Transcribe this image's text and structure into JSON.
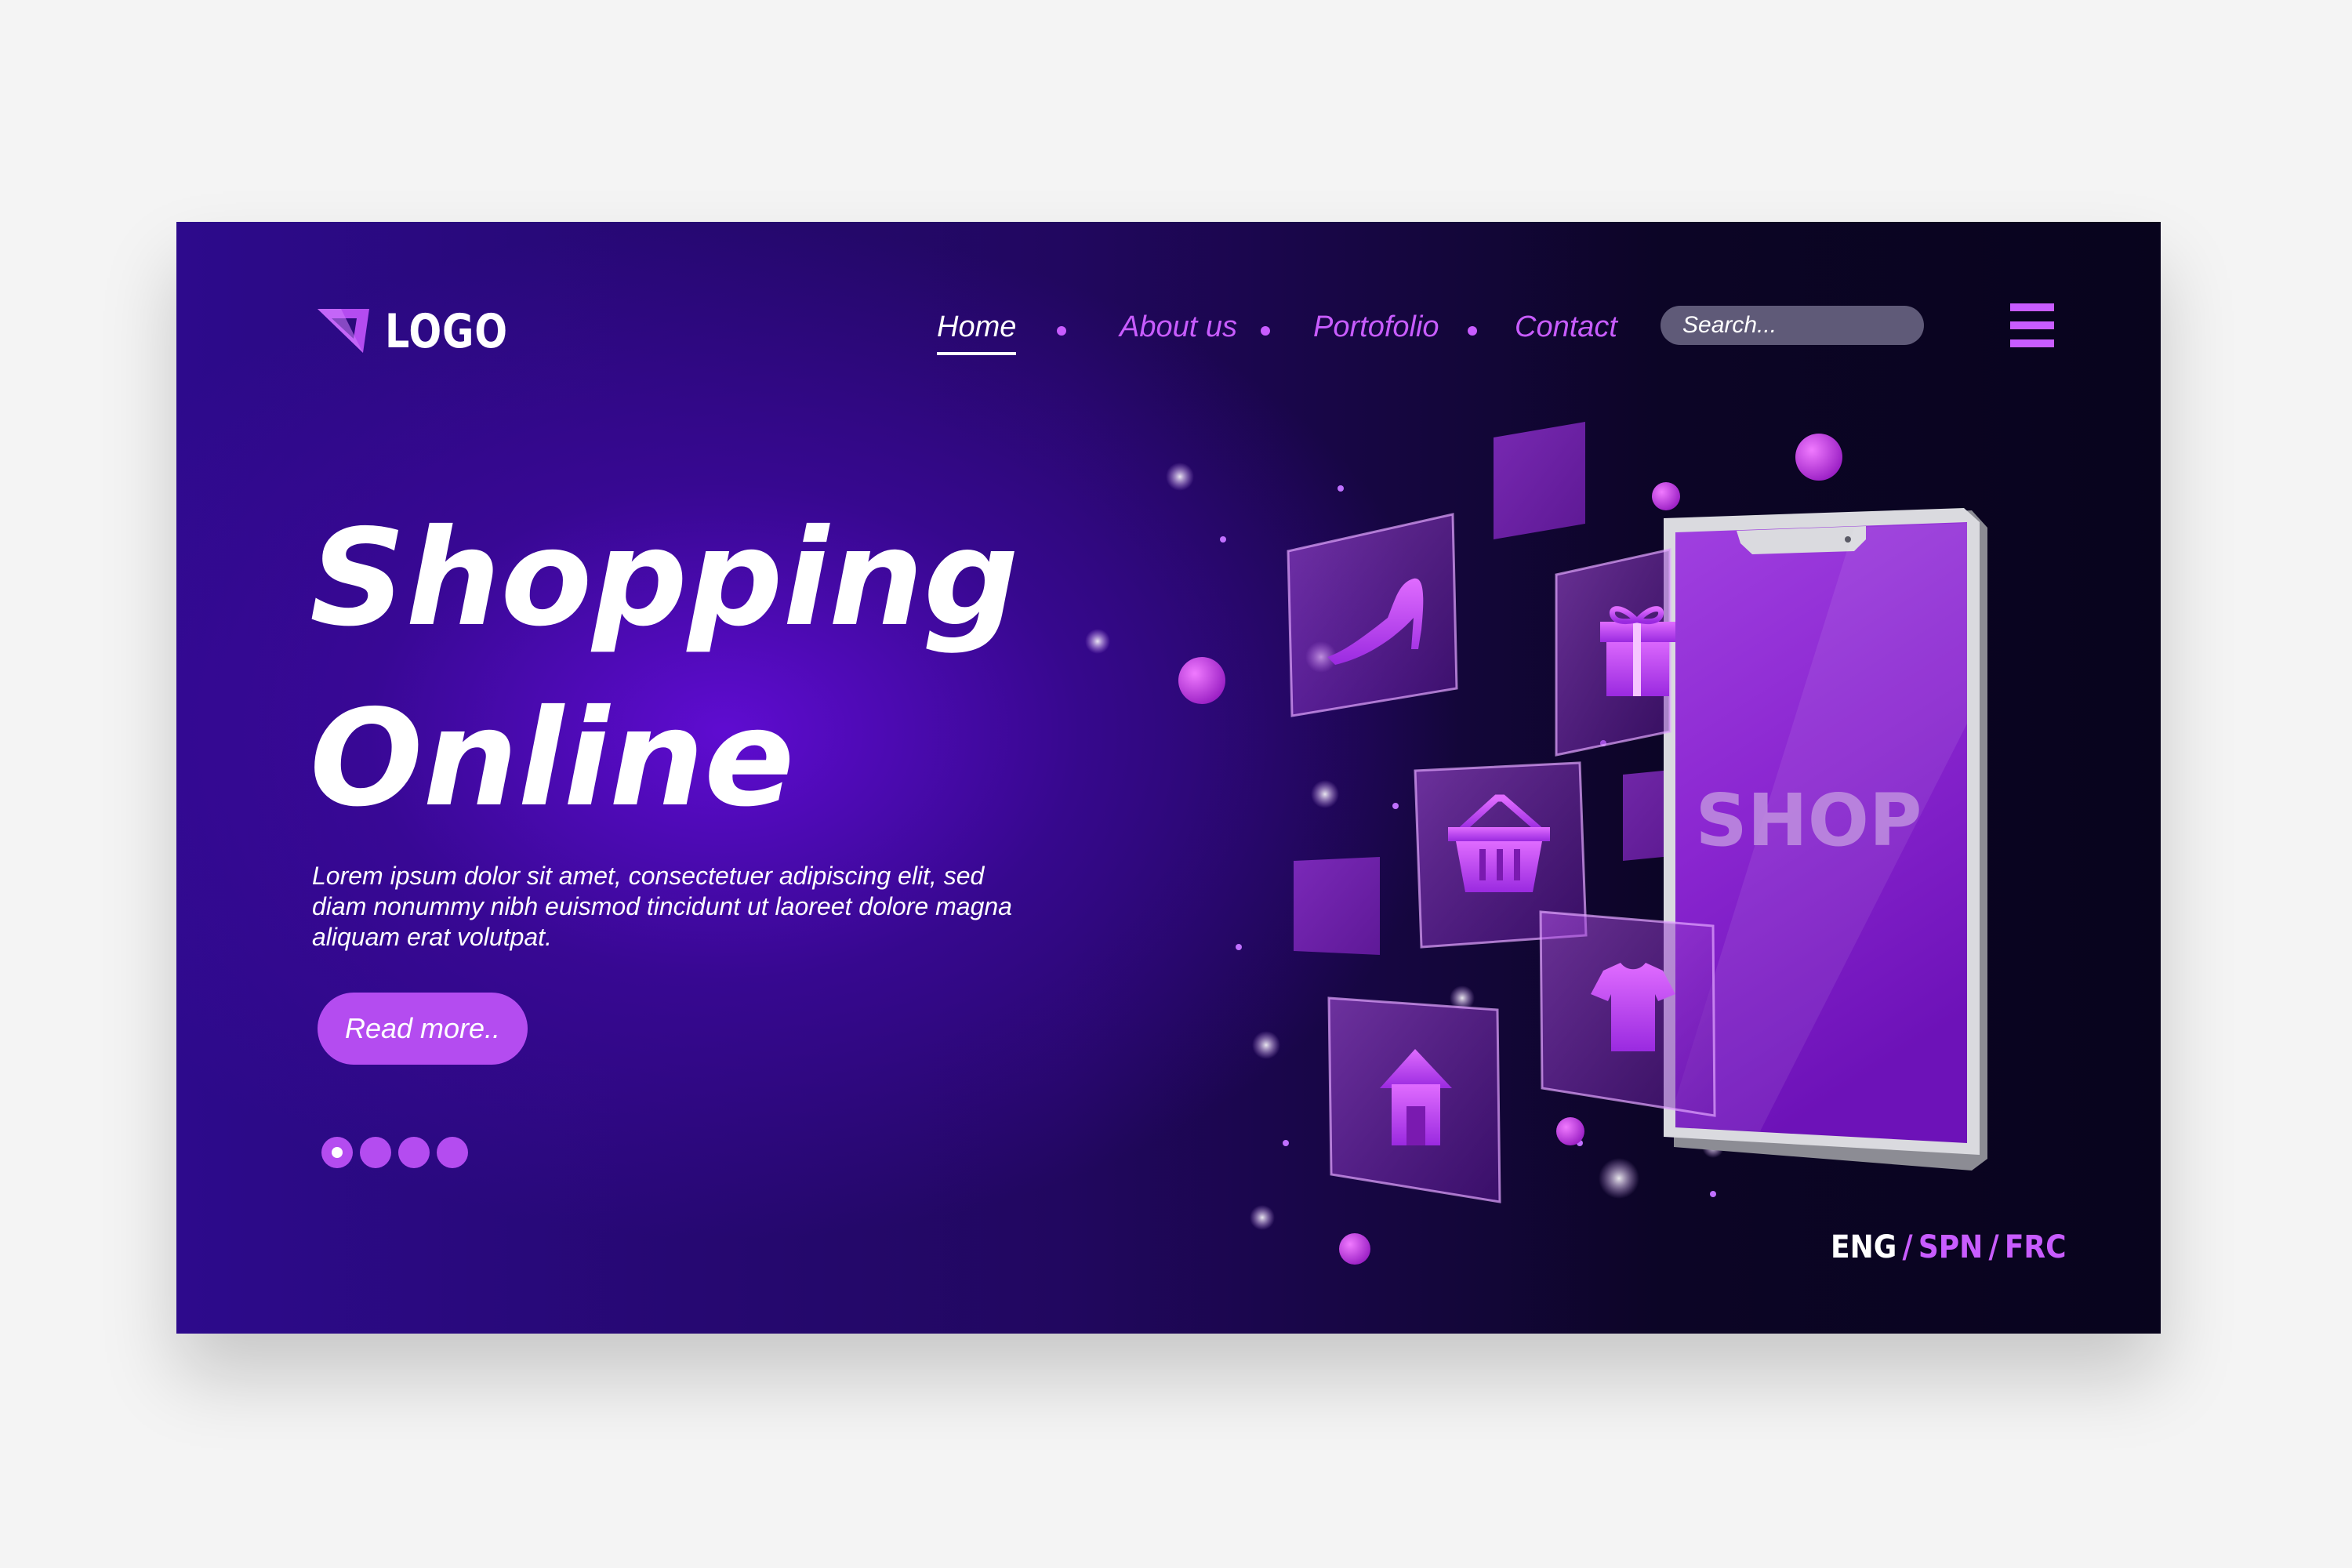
{
  "brand": {
    "logo_text": "LOGO"
  },
  "nav": {
    "items": [
      {
        "label": "Home",
        "active": true
      },
      {
        "label": "About us",
        "active": false
      },
      {
        "label": "Portofolio",
        "active": false
      },
      {
        "label": "Contact",
        "active": false
      }
    ]
  },
  "search": {
    "placeholder": "Search..."
  },
  "hero": {
    "title_line1": "Shopping",
    "title_line2": "Online",
    "description": "Lorem ipsum dolor sit amet, consectetuer adipiscing elit, sed diam nonummy nibh euismod tincidunt ut laoreet dolore magna aliquam erat volutpat.",
    "cta_label": "Read more..",
    "slider": {
      "total": 4,
      "active_index": 0
    }
  },
  "illustration": {
    "phone_label": "SHOP",
    "icons": [
      "high-heel-icon",
      "gift-icon",
      "basket-icon",
      "tshirt-icon",
      "home-icon"
    ]
  },
  "languages": {
    "items": [
      "ENG",
      "SPN",
      "FRC"
    ],
    "active": "ENG"
  },
  "colors": {
    "accent": "#c85cff",
    "button": "#b44cf0",
    "background_dark": "#0c0526",
    "background_glow": "#620cd6",
    "text": "#ffffff"
  }
}
